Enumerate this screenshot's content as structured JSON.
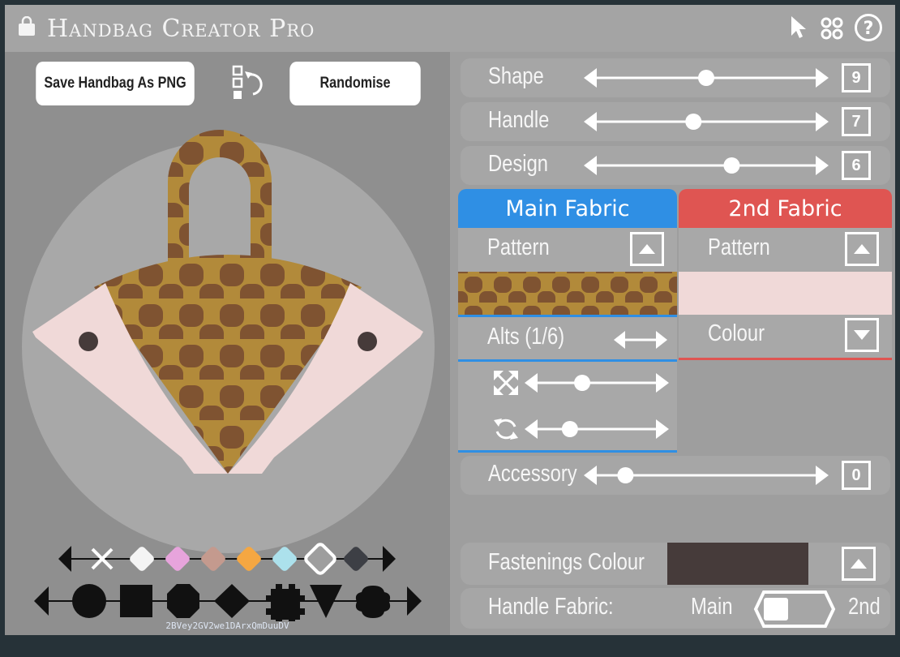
{
  "app": {
    "title": "Handbag Creator Pro",
    "icons": [
      "handbag-icon",
      "cursor-icon",
      "dots-grid-icon",
      "help-icon"
    ]
  },
  "toolbar": {
    "save_label": "Save Handbag As PNG",
    "randomise_label": "Randomise",
    "reorder_icon": "reorder-swap-icon"
  },
  "colors": {
    "main_fabric_tab": "#2f8fe4",
    "second_fabric_tab": "#df5552",
    "fabric_brown": "#b28a3a",
    "fabric_spot": "#7f5331",
    "second_fabric_pink": "#f0d9d8",
    "fastenings": "#463b3a"
  },
  "palette_colors": [
    "none",
    "#f4f4f4",
    "#e7a4dc",
    "#c49a8e",
    "#f5a742",
    "#ace1ec",
    "#9e9e9e",
    "#3d3f45"
  ],
  "shape_options": [
    "circle",
    "square",
    "octagon",
    "diamond",
    "cog",
    "triangle",
    "blob"
  ],
  "bag_code": "2BVey2GV2we1DArxQmDuuDV",
  "sliders": {
    "shape": {
      "label": "Shape",
      "value": "9",
      "level": 0.5
    },
    "handle": {
      "label": "Handle",
      "value": "7",
      "level": 0.44
    },
    "design": {
      "label": "Design",
      "value": "6",
      "level": 0.62
    },
    "accessory": {
      "label": "Accessory",
      "value": "0",
      "level": 0.12
    }
  },
  "main_fabric": {
    "tab": "Main Fabric",
    "pattern_label": "Pattern",
    "alts_label": "Alts (1/6)",
    "scale_level": 0.37,
    "rotate_level": 0.26
  },
  "second_fabric": {
    "tab": "2nd Fabric",
    "pattern_label": "Pattern",
    "colour_label": "Colour"
  },
  "fastenings": {
    "label": "Fastenings Colour"
  },
  "handle_fabric": {
    "label": "Handle Fabric:",
    "main": "Main",
    "second": "2nd"
  }
}
